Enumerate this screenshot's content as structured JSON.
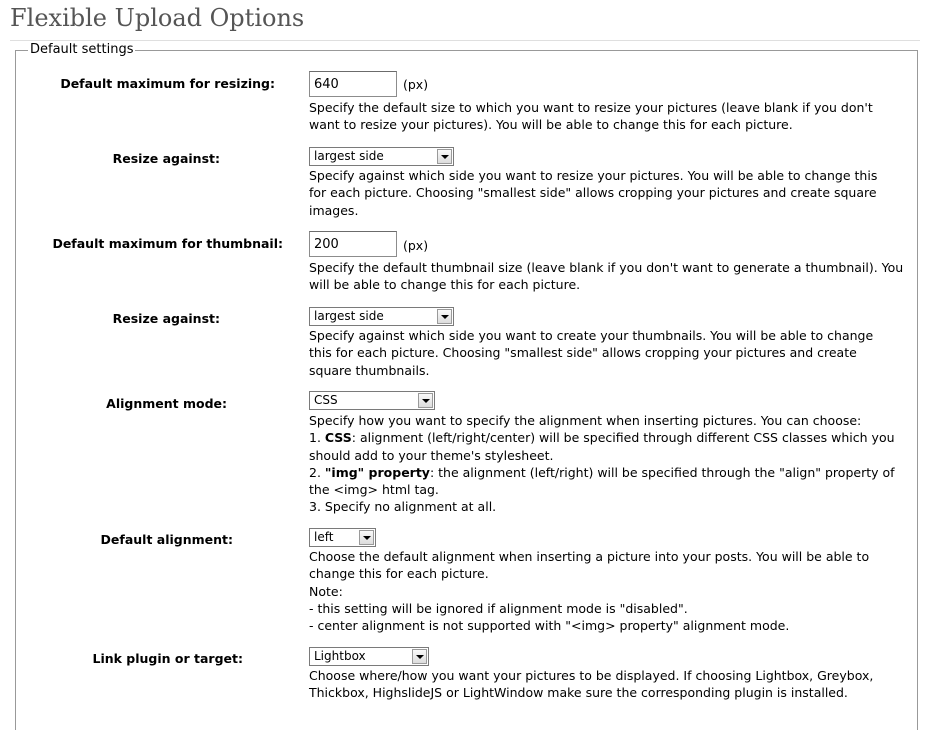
{
  "page": {
    "title": "Flexible Upload Options"
  },
  "fieldset": {
    "legend": "Default settings"
  },
  "resize_max": {
    "label": "Default maximum for resizing:",
    "value": "640",
    "unit": "(px)",
    "desc": [
      "Specify the default size to which you want to resize your pictures (leave blank if you don't",
      "want to resize your pictures). You will be able to change this for each picture."
    ]
  },
  "resize_against": {
    "label": "Resize against:",
    "selected": "largest side",
    "desc": [
      "Specify against which side you want to resize your pictures. You will be able to change this",
      "for each picture. Choosing \"smallest side\" allows cropping your pictures and create square",
      "images."
    ]
  },
  "thumb_max": {
    "label": "Default maximum for thumbnail:",
    "value": "200",
    "unit": "(px)",
    "desc": [
      "Specify the default thumbnail size (leave blank if you don't want to generate a thumbnail). You",
      "will be able to change this for each picture."
    ]
  },
  "thumb_against": {
    "label": "Resize against:",
    "selected": "largest side",
    "desc": [
      "Specify against which side you want to create your thumbnails. You will be able to change",
      "this for each picture. Choosing \"smallest side\" allows cropping your pictures and create",
      "square thumbnails."
    ]
  },
  "align_mode": {
    "label": "Alignment mode:",
    "selected": "CSS",
    "intro": "Specify how you want to specify the alignment when inserting pictures. You can choose:",
    "opt1_prefix": "1. ",
    "opt1_bold": "CSS",
    "opt1_rest": ": alignment (left/right/center) will be specified through different CSS classes which you",
    "opt1_cont": "should add to your theme's stylesheet.",
    "opt2_prefix": "2. ",
    "opt2_bold": "\"img\" property",
    "opt2_rest": ": the alignment (left/right) will be specified through the \"align\" property of",
    "opt2_cont": "the <img> html tag.",
    "opt3": "3. Specify no alignment at all."
  },
  "default_align": {
    "label": "Default alignment:",
    "selected": "left",
    "desc": [
      "Choose the default alignment when inserting a picture into your posts. You will be able to",
      "change this for each picture.",
      "Note:",
      "- this setting will be ignored if alignment mode is \"disabled\".",
      "- center alignment is not supported with \"<img> property\" alignment mode."
    ]
  },
  "link_plugin": {
    "label": "Link plugin or target:",
    "selected": "Lightbox",
    "desc": [
      "Choose where/how you want your pictures to be displayed. If choosing Lightbox, Greybox,",
      "Thickbox, HighslideJS or LightWindow make sure the corresponding plugin is installed."
    ]
  }
}
